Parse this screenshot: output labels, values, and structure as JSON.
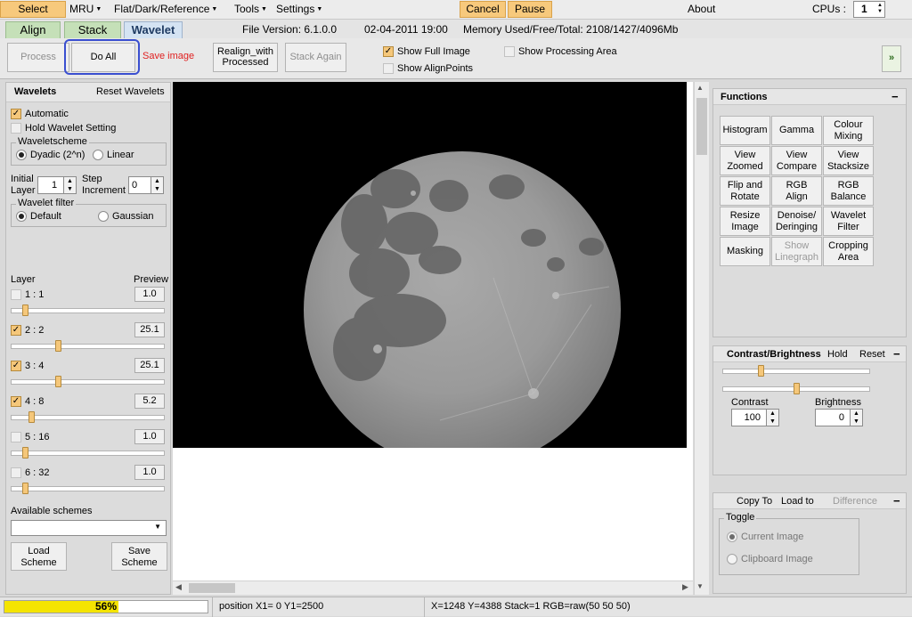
{
  "menubar": {
    "select_label": "Select",
    "mru_label": "MRU",
    "flat_label": "Flat/Dark/Reference",
    "tools_label": "Tools",
    "settings_label": "Settings",
    "cancel_label": "Cancel",
    "pause_label": "Pause",
    "about_label": "About",
    "cpus_label": "CPUs :",
    "cpus_value": "1"
  },
  "tabs": [
    {
      "label": "Align"
    },
    {
      "label": "Stack"
    },
    {
      "label": "Wavelet"
    }
  ],
  "info": {
    "file_version": "File Version: 6.1.0.0",
    "date": "02-04-2011 19:00",
    "memory": "Memory Used/Free/Total: 2108/1427/4096Mb"
  },
  "toolbar": {
    "process_label": "Process",
    "do_all_label": "Do All",
    "save_image_label": "Save image",
    "realign_label_1": "Realign_with",
    "realign_label_2": "Processed",
    "stack_again_label": "Stack Again",
    "show_full_image_label": "Show Full Image",
    "show_alignpoints_label": "Show AlignPoints",
    "show_processing_area_label": "Show Processing Area",
    "expand_label": "»"
  },
  "wavelets": {
    "title": "Wavelets",
    "reset_label": "Reset Wavelets",
    "automatic_label": "Automatic",
    "hold_label": "Hold Wavelet Setting",
    "scheme_group": "Waveletscheme",
    "dyadic_label": "Dyadic (2^n)",
    "linear_label": "Linear",
    "initial_layer_label_1": "Initial",
    "initial_layer_label_2": "Layer",
    "initial_layer_value": "1",
    "step_increment_label_1": "Step",
    "step_increment_label_2": "Increment",
    "step_increment_value": "0",
    "filter_group": "Wavelet filter",
    "default_label": "Default",
    "gaussian_label": "Gaussian",
    "layer_header": "Layer",
    "preview_header": "Preview",
    "layers": [
      {
        "label": "1 : 1",
        "checked": false,
        "value": "1.0",
        "slider": 0.08
      },
      {
        "label": "2 : 2",
        "checked": true,
        "value": "25.1",
        "slider": 0.3
      },
      {
        "label": "3 : 4",
        "checked": true,
        "value": "25.1",
        "slider": 0.3
      },
      {
        "label": "4 : 8",
        "checked": true,
        "value": "5.2",
        "slider": 0.12
      },
      {
        "label": "5 : 16",
        "checked": false,
        "value": "1.0",
        "slider": 0.08
      },
      {
        "label": "6 : 32",
        "checked": false,
        "value": "1.0",
        "slider": 0.08
      }
    ],
    "available_schemes_label": "Available schemes",
    "load_label_1": "Load",
    "load_label_2": "Scheme",
    "save_label_1": "Save",
    "save_label_2": "Scheme"
  },
  "functions": {
    "title": "Functions",
    "collapse": "−",
    "buttons": [
      [
        "Histogram",
        "Gamma",
        "Colour|Mixing"
      ],
      [
        "View|Zoomed",
        "View|Compare",
        "View|Stacksize"
      ],
      [
        "Flip and|Rotate",
        "RGB|Align",
        "RGB|Balance"
      ],
      [
        "Resize|Image",
        "Denoise/|Deringing",
        "Wavelet|Filter"
      ],
      [
        "Masking",
        "Show|Linegraph",
        "Cropping|Area"
      ]
    ]
  },
  "contrast": {
    "title": "Contrast/Brightness",
    "hold_label": "Hold",
    "reset_label": "Reset",
    "collapse": "−",
    "contrast_label": "Contrast",
    "contrast_value": "100",
    "brightness_label": "Brightness",
    "brightness_value": "0",
    "slider1": 0.25,
    "slider2": 0.5
  },
  "copy": {
    "copy_to_label": "Copy To",
    "load_to_label": "Load to",
    "difference_label": "Difference",
    "collapse": "−",
    "toggle_label": "Toggle",
    "current_image_label": "Current Image",
    "clipboard_image_label": "Clipboard Image"
  },
  "status": {
    "progress_label": "56%",
    "progress": 0.56,
    "position": "position X1= 0 Y1=2500",
    "coords": "X=1248 Y=4388 Stack=1 RGB=raw(50 50 50)"
  },
  "colors": {
    "accent_orange": "#f7c97c",
    "progress_yellow": "#f4e400",
    "do_all_highlight": "#3a4fd0",
    "save_red": "#e02020"
  }
}
